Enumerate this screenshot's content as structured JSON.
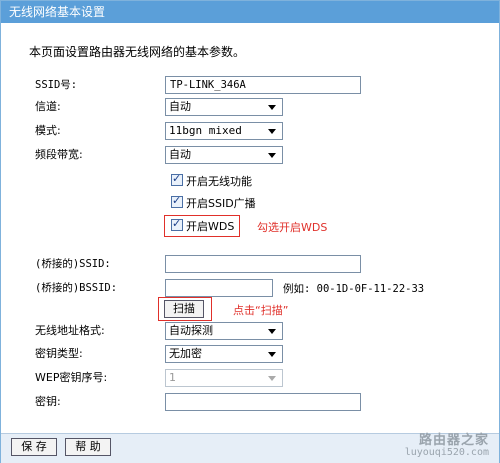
{
  "title": "无线网络基本设置",
  "intro": "本页面设置路由器无线网络的基本参数。",
  "fields": {
    "ssid": {
      "label": "SSID号:",
      "value": "TP-LINK_346A"
    },
    "channel": {
      "label": "信道:",
      "value": "自动"
    },
    "mode": {
      "label": "模式:",
      "value": "11bgn mixed"
    },
    "bandwidth": {
      "label": "频段带宽:",
      "value": "自动"
    }
  },
  "checkboxes": {
    "wireless": {
      "label": "开启无线功能",
      "checked": true
    },
    "ssid_broadcast": {
      "label": "开启SSID广播",
      "checked": true
    },
    "wds": {
      "label": "开启WDS",
      "checked": true
    }
  },
  "annotations": {
    "wds_note": "勾选开启WDS",
    "scan_note": "点击“扫描”"
  },
  "bridge": {
    "ssid_label": "(桥接的)SSID:",
    "ssid_value": "",
    "bssid_label": "(桥接的)BSSID:",
    "bssid_value": "",
    "example": "例如: 00-1D-0F-11-22-33",
    "scan_button": "扫描"
  },
  "security": {
    "address_format": {
      "label": "无线地址格式:",
      "value": "自动探测"
    },
    "key_type": {
      "label": "密钥类型:",
      "value": "无加密"
    },
    "wep_index": {
      "label": "WEP密钥序号:",
      "value": "1"
    },
    "key": {
      "label": "密钥:",
      "value": ""
    }
  },
  "footer": {
    "save": "保 存",
    "help": "帮 助"
  },
  "watermark": {
    "line1": "路由器之家",
    "line2": "luyouqi520.com"
  }
}
